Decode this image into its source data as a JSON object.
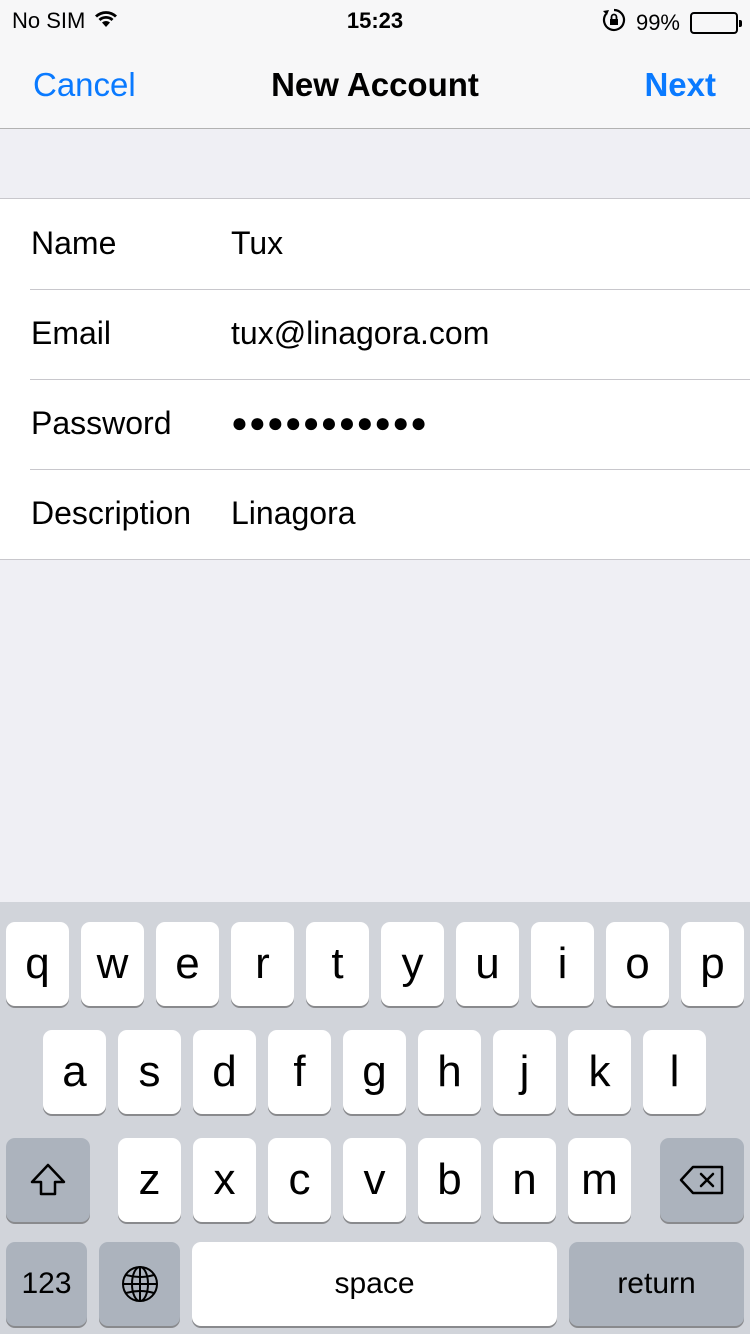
{
  "status_bar": {
    "carrier": "No SIM",
    "time": "15:23",
    "battery": "99%",
    "battery_level": 0.99
  },
  "nav": {
    "cancel": "Cancel",
    "title": "New Account",
    "next": "Next"
  },
  "form": {
    "rows": [
      {
        "label": "Name",
        "value": "Tux"
      },
      {
        "label": "Email",
        "value": "tux@linagora.com"
      },
      {
        "label": "Password",
        "value": "●●●●●●●●●●●"
      },
      {
        "label": "Description",
        "value": "Linagora"
      }
    ]
  },
  "keyboard": {
    "row1": [
      "q",
      "w",
      "e",
      "r",
      "t",
      "y",
      "u",
      "i",
      "o",
      "p"
    ],
    "row2": [
      "a",
      "s",
      "d",
      "f",
      "g",
      "h",
      "j",
      "k",
      "l"
    ],
    "row3": [
      "z",
      "x",
      "c",
      "v",
      "b",
      "n",
      "m"
    ],
    "numbers_key": "123",
    "space_key": "space",
    "return_key": "return",
    "icons": {
      "shift": "shift-icon",
      "delete": "backspace-icon",
      "globe": "globe-icon"
    }
  },
  "colors": {
    "accent": "#0a7aff",
    "background": "#efeff4",
    "keyboard_bg": "#d1d4da",
    "key_dark": "#acb3bd"
  }
}
